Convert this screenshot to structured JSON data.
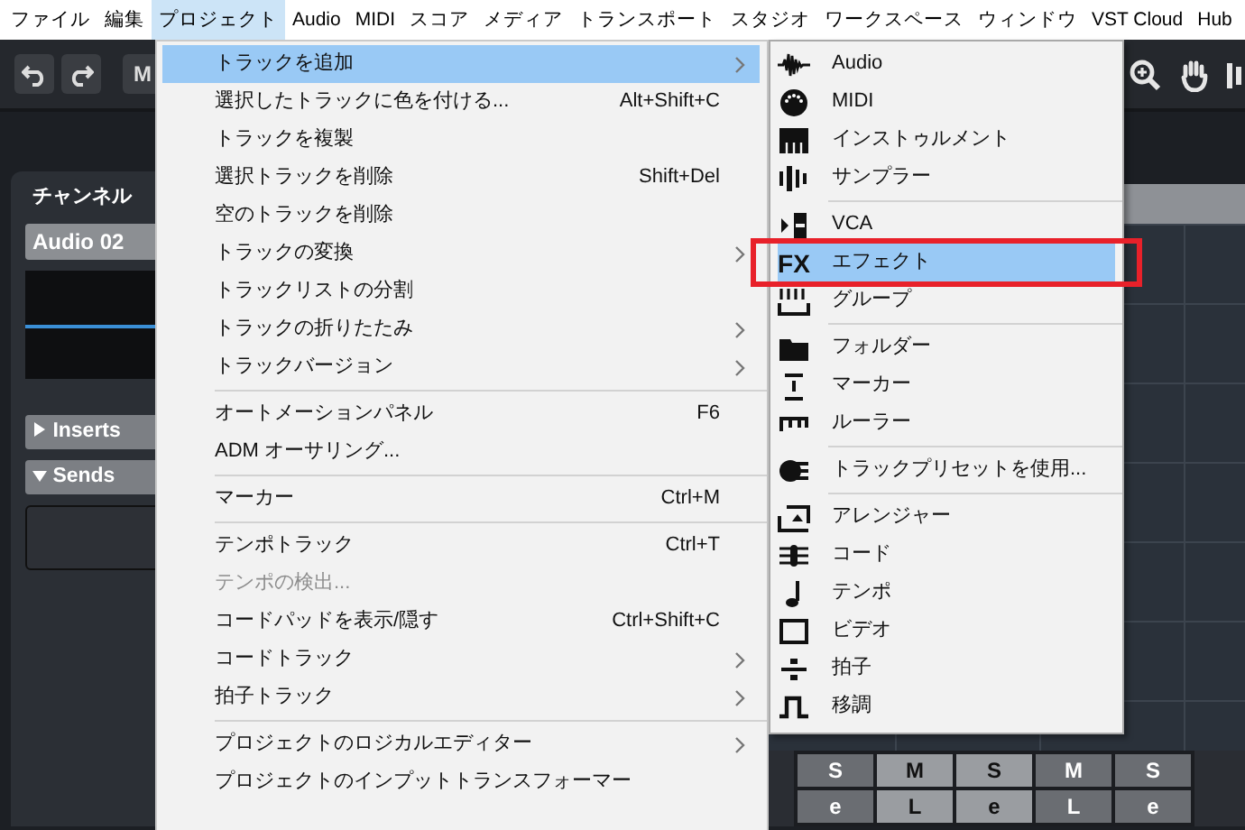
{
  "menubar": [
    {
      "label": "ファイル",
      "selected": false
    },
    {
      "label": "編集",
      "selected": false
    },
    {
      "label": "プロジェクト",
      "selected": true
    },
    {
      "label": "Audio",
      "selected": false
    },
    {
      "label": "MIDI",
      "selected": false
    },
    {
      "label": "スコア",
      "selected": false
    },
    {
      "label": "メディア",
      "selected": false
    },
    {
      "label": "トランスポート",
      "selected": false
    },
    {
      "label": "スタジオ",
      "selected": false
    },
    {
      "label": "ワークスペース",
      "selected": false
    },
    {
      "label": "ウィンドウ",
      "selected": false
    },
    {
      "label": "VST Cloud",
      "selected": false
    },
    {
      "label": "Hub",
      "selected": false
    }
  ],
  "toolbar": {
    "button_label": "M"
  },
  "channel_panel": {
    "title": "チャンネル",
    "track_name": "Audio 02",
    "sections": [
      {
        "label": "Inserts",
        "expanded": false
      },
      {
        "label": "Sends",
        "expanded": true
      }
    ]
  },
  "mixer_buttons": [
    [
      "S",
      "M",
      "S",
      "M",
      "S"
    ],
    [
      "e",
      "L",
      "e",
      "L",
      "e"
    ]
  ],
  "project_menu": {
    "groups": [
      [
        {
          "label": "トラックを追加",
          "submenu": true,
          "disabled": false,
          "selected": true
        },
        {
          "label": "選択したトラックに色を付ける...",
          "shortcut": "Alt+Shift+C",
          "submenu": false,
          "disabled": false,
          "selected": false
        },
        {
          "label": "トラックを複製",
          "submenu": false,
          "disabled": false,
          "selected": false
        },
        {
          "label": "選択トラックを削除",
          "shortcut": "Shift+Del",
          "submenu": false,
          "disabled": false,
          "selected": false
        },
        {
          "label": "空のトラックを削除",
          "submenu": false,
          "disabled": false,
          "selected": false
        },
        {
          "label": "トラックの変換",
          "submenu": true,
          "disabled": false,
          "selected": false
        },
        {
          "label": "トラックリストの分割",
          "submenu": false,
          "disabled": false,
          "selected": false
        },
        {
          "label": "トラックの折りたたみ",
          "submenu": true,
          "disabled": false,
          "selected": false
        },
        {
          "label": "トラックバージョン",
          "submenu": true,
          "disabled": false,
          "selected": false
        }
      ],
      [
        {
          "label": "オートメーションパネル",
          "shortcut": "F6",
          "submenu": false,
          "disabled": false,
          "selected": false
        },
        {
          "label": "ADM オーサリング...",
          "submenu": false,
          "disabled": false,
          "selected": false
        }
      ],
      [
        {
          "label": "マーカー",
          "shortcut": "Ctrl+M",
          "submenu": false,
          "disabled": false,
          "selected": false
        }
      ],
      [
        {
          "label": "テンポトラック",
          "shortcut": "Ctrl+T",
          "submenu": false,
          "disabled": false,
          "selected": false
        },
        {
          "label": "テンポの検出...",
          "submenu": false,
          "disabled": true,
          "selected": false
        },
        {
          "label": "コードパッドを表示/隠す",
          "shortcut": "Ctrl+Shift+C",
          "submenu": false,
          "disabled": false,
          "selected": false
        },
        {
          "label": "コードトラック",
          "submenu": true,
          "disabled": false,
          "selected": false
        },
        {
          "label": "拍子トラック",
          "submenu": true,
          "disabled": false,
          "selected": false
        }
      ],
      [
        {
          "label": "プロジェクトのロジカルエディター",
          "submenu": true,
          "disabled": false,
          "selected": false
        },
        {
          "label": "プロジェクトのインプットトランスフォーマー",
          "submenu": false,
          "disabled": false,
          "selected": false
        }
      ]
    ]
  },
  "add_track_submenu": {
    "groups": [
      [
        {
          "label": "Audio",
          "selected": false
        },
        {
          "label": "MIDI",
          "selected": false
        },
        {
          "label": "インストゥルメント",
          "selected": false
        },
        {
          "label": "サンプラー",
          "selected": false
        }
      ],
      [
        {
          "label": "VCA",
          "selected": false
        },
        {
          "label": "エフェクト",
          "icon_text": "FX",
          "selected": true
        },
        {
          "label": "グループ",
          "selected": false
        }
      ],
      [
        {
          "label": "フォルダー",
          "selected": false
        },
        {
          "label": "マーカー",
          "selected": false
        },
        {
          "label": "ルーラー",
          "selected": false
        }
      ],
      [
        {
          "label": "トラックプリセットを使用...",
          "selected": false
        }
      ],
      [
        {
          "label": "アレンジャー",
          "selected": false
        },
        {
          "label": "コード",
          "selected": false
        },
        {
          "label": "テンポ",
          "selected": false
        },
        {
          "label": "ビデオ",
          "selected": false
        },
        {
          "label": "拍子",
          "selected": false
        },
        {
          "label": "移調",
          "selected": false
        }
      ]
    ]
  }
}
